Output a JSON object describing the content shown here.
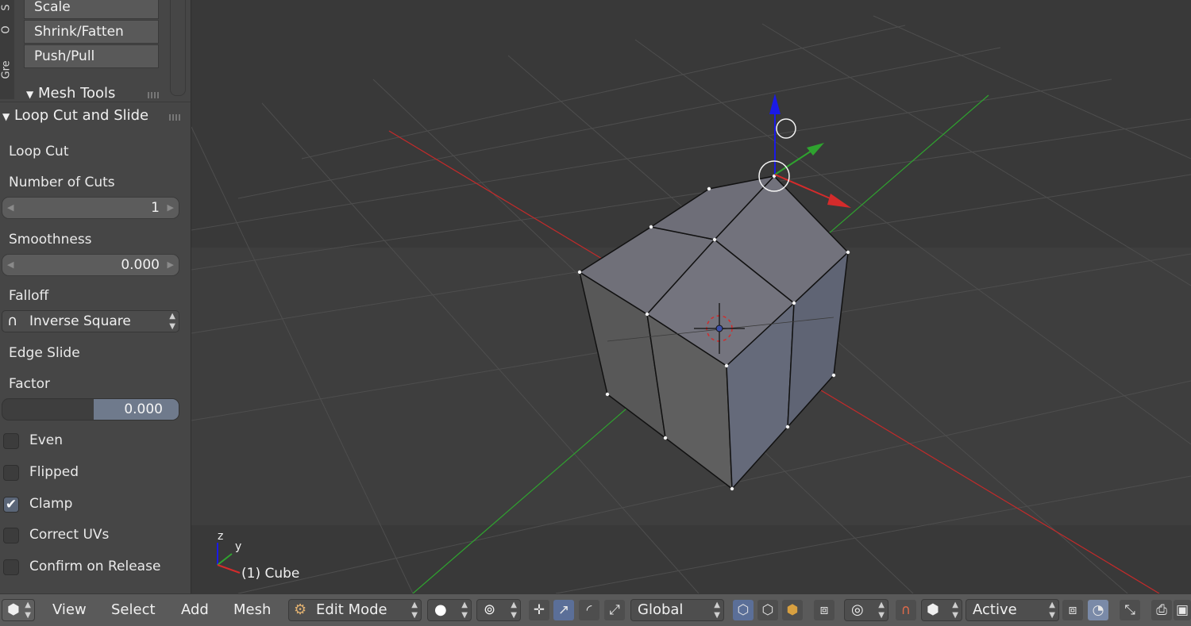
{
  "sidebar": {
    "tabs": [
      "S",
      "O",
      "Gre"
    ],
    "tool_buttons": [
      "Scale",
      "Shrink/Fatten",
      "Push/Pull"
    ],
    "mesh_tools_header": "Mesh Tools",
    "operator_header": "Loop Cut and Slide",
    "loop_cut_label": "Loop Cut",
    "number_of_cuts": {
      "label": "Number of Cuts",
      "value": "1"
    },
    "smoothness": {
      "label": "Smoothness",
      "value": "0.000"
    },
    "falloff": {
      "label": "Falloff",
      "value": "Inverse Square",
      "icon": "inverse-square-curve-icon"
    },
    "edge_slide_label": "Edge Slide",
    "factor": {
      "label": "Factor",
      "value": "0.000"
    },
    "checkboxes": [
      {
        "label": "Even",
        "checked": false
      },
      {
        "label": "Flipped",
        "checked": false
      },
      {
        "label": "Clamp",
        "checked": true
      },
      {
        "label": "Correct UVs",
        "checked": false
      },
      {
        "label": "Confirm on Release",
        "checked": false
      }
    ]
  },
  "viewport": {
    "object_label": "(1) Cube",
    "axis_z": "z",
    "axis_y": "y",
    "colors": {
      "x_axis": "#c42a2a",
      "y_axis": "#2fa32f",
      "z_axis": "#1a1ae6",
      "mesh_face": "#6e6e78"
    }
  },
  "bottombar": {
    "editor_icon": "3d-view-cube-icon",
    "menus": [
      "View",
      "Select",
      "Add",
      "Mesh"
    ],
    "mode": "Edit Mode",
    "transform_orientation": "Global",
    "pivot": "Active"
  }
}
